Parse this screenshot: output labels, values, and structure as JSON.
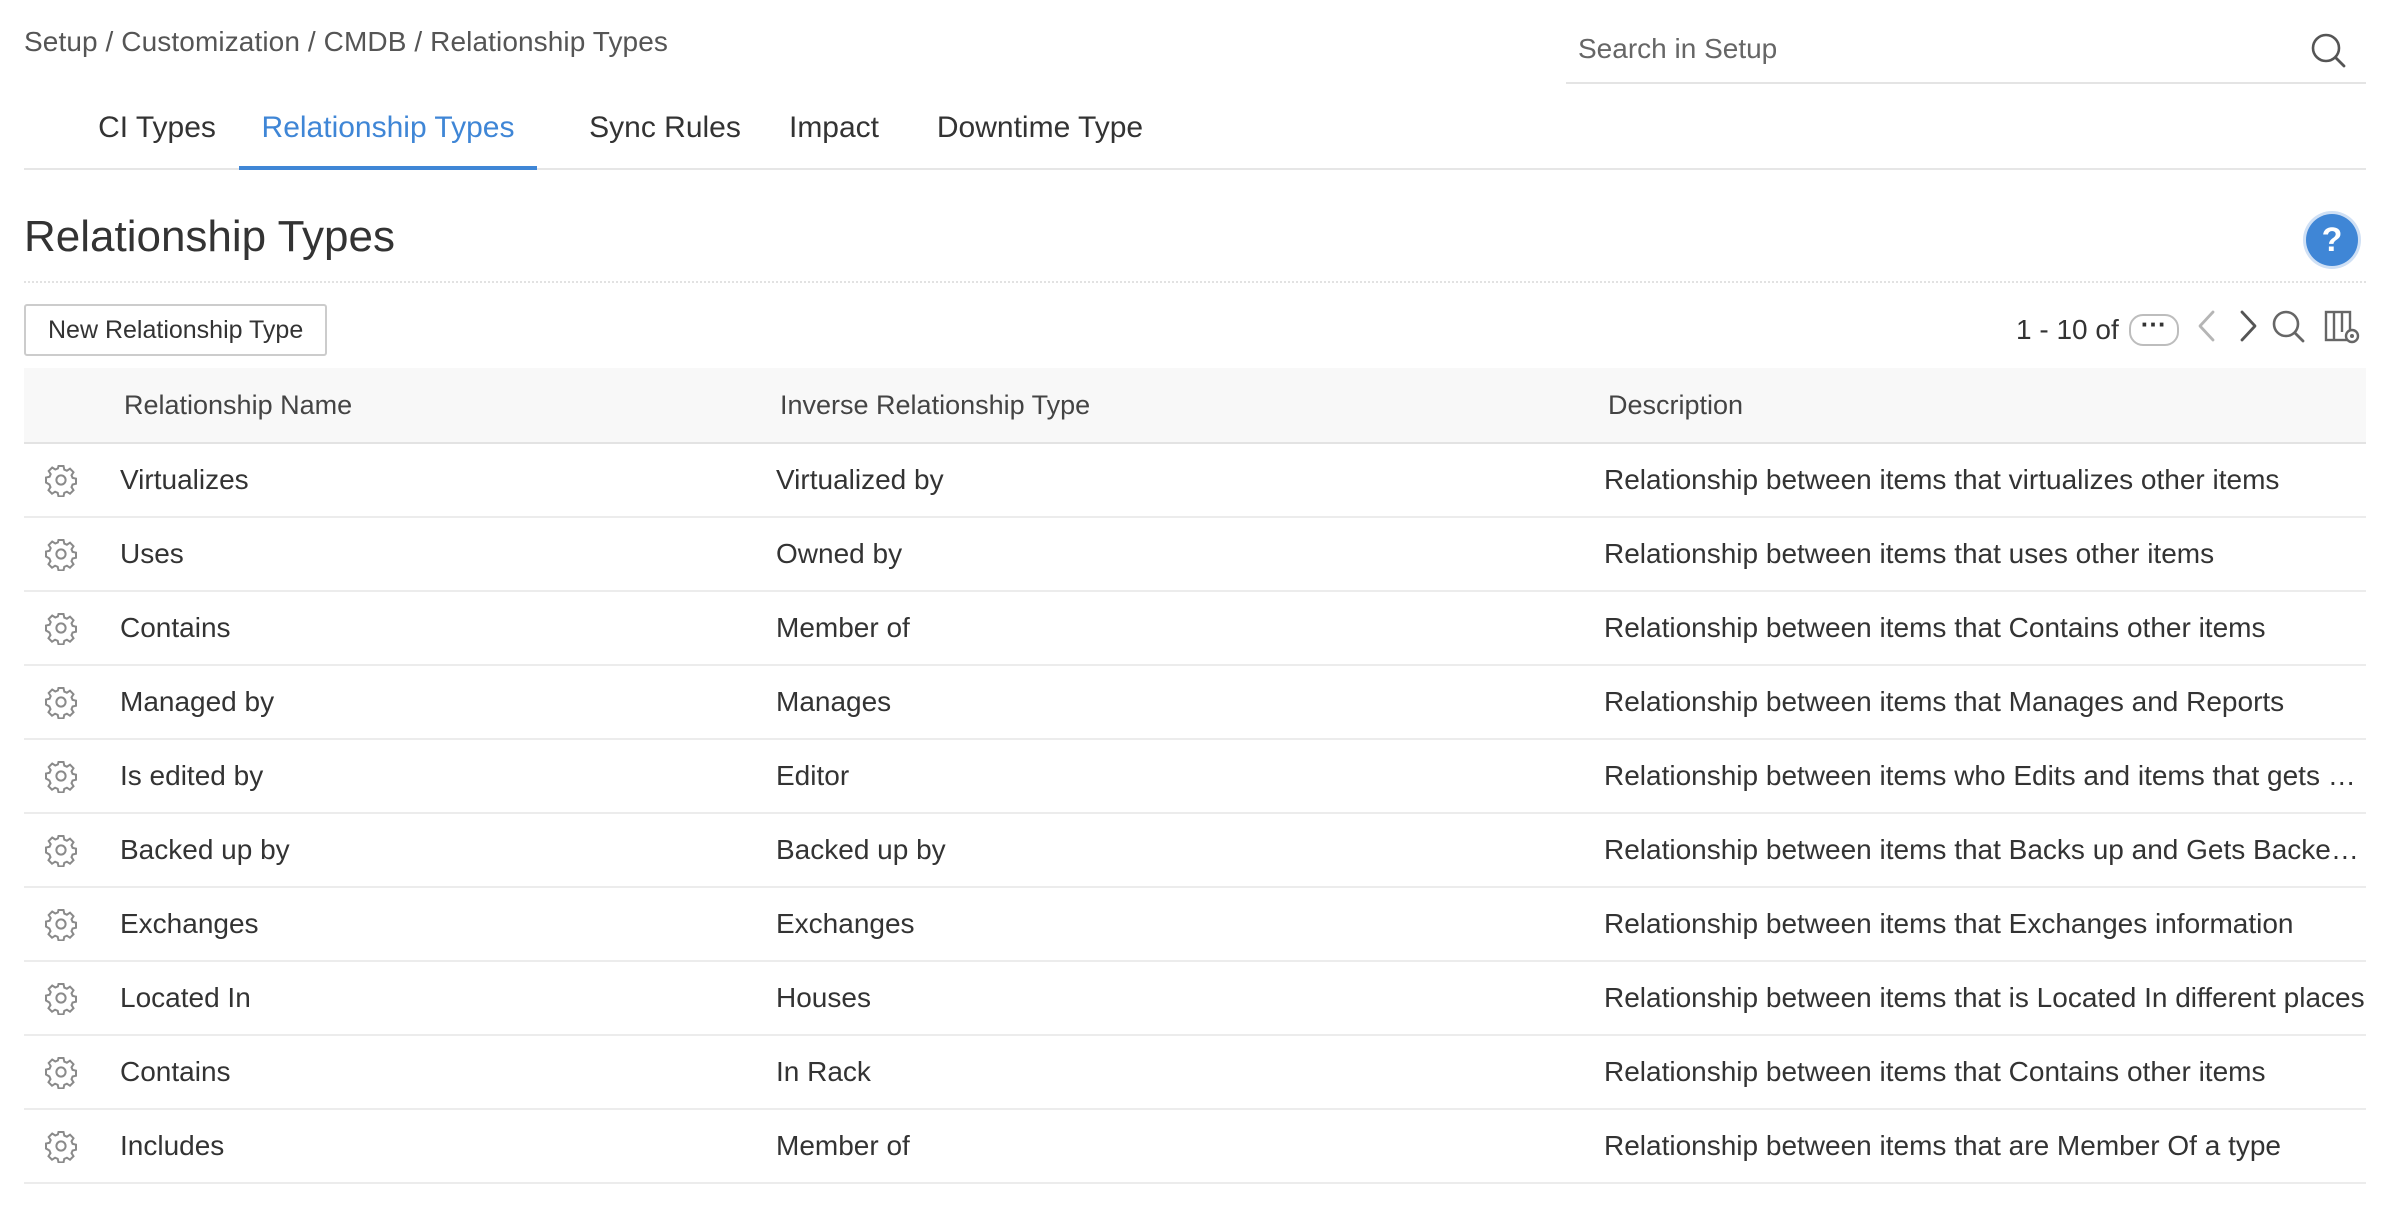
{
  "breadcrumb": "Setup / Customization / CMDB / Relationship Types",
  "search": {
    "placeholder": "Search in Setup",
    "value": ""
  },
  "tabs": [
    {
      "label": "CI Types",
      "active": false
    },
    {
      "label": "Relationship Types",
      "active": true
    },
    {
      "label": "Sync Rules",
      "active": false
    },
    {
      "label": "Impact",
      "active": false
    },
    {
      "label": "Downtime Type",
      "active": false
    }
  ],
  "page": {
    "title": "Relationship Types",
    "help_label": "?"
  },
  "toolbar": {
    "new_button_label": "New Relationship Type",
    "pager_range": "1 - 10 of",
    "count_button_label": "···"
  },
  "colors": {
    "accent": "#3f86d6",
    "text": "#333333",
    "border": "#e3e3e3",
    "icon_gray": "#8a8a8a"
  },
  "icons": {
    "search": "search-icon",
    "help": "help-icon",
    "prev": "chevron-left-icon",
    "next": "chevron-right-icon",
    "table_search": "search-icon",
    "columns": "column-settings-icon",
    "row_action": "gear-icon"
  },
  "table": {
    "columns": [
      "Relationship Name",
      "Inverse Relationship Type",
      "Description"
    ],
    "rows": [
      {
        "name": "Virtualizes",
        "inverse": "Virtualized by",
        "description": "Relationship between items that virtualizes other items"
      },
      {
        "name": "Uses",
        "inverse": "Owned by",
        "description": "Relationship between items that uses other items"
      },
      {
        "name": "Contains",
        "inverse": "Member of",
        "description": "Relationship between items that Contains other items"
      },
      {
        "name": "Managed by",
        "inverse": "Manages",
        "description": "Relationship between items that Manages and Reports"
      },
      {
        "name": "Is edited by",
        "inverse": "Editor",
        "description": "Relationship between items who Edits and items that gets e..."
      },
      {
        "name": "Backed up by",
        "inverse": "Backed up by",
        "description": "Relationship between items that Backs up and Gets Backed ..."
      },
      {
        "name": "Exchanges",
        "inverse": "Exchanges",
        "description": "Relationship between items that Exchanges information"
      },
      {
        "name": "Located In",
        "inverse": "Houses",
        "description": "Relationship between items that is Located In different places"
      },
      {
        "name": "Contains",
        "inverse": "In Rack",
        "description": "Relationship between items that Contains other items"
      },
      {
        "name": "Includes",
        "inverse": "Member of",
        "description": "Relationship between items that are Member Of a type"
      }
    ]
  }
}
